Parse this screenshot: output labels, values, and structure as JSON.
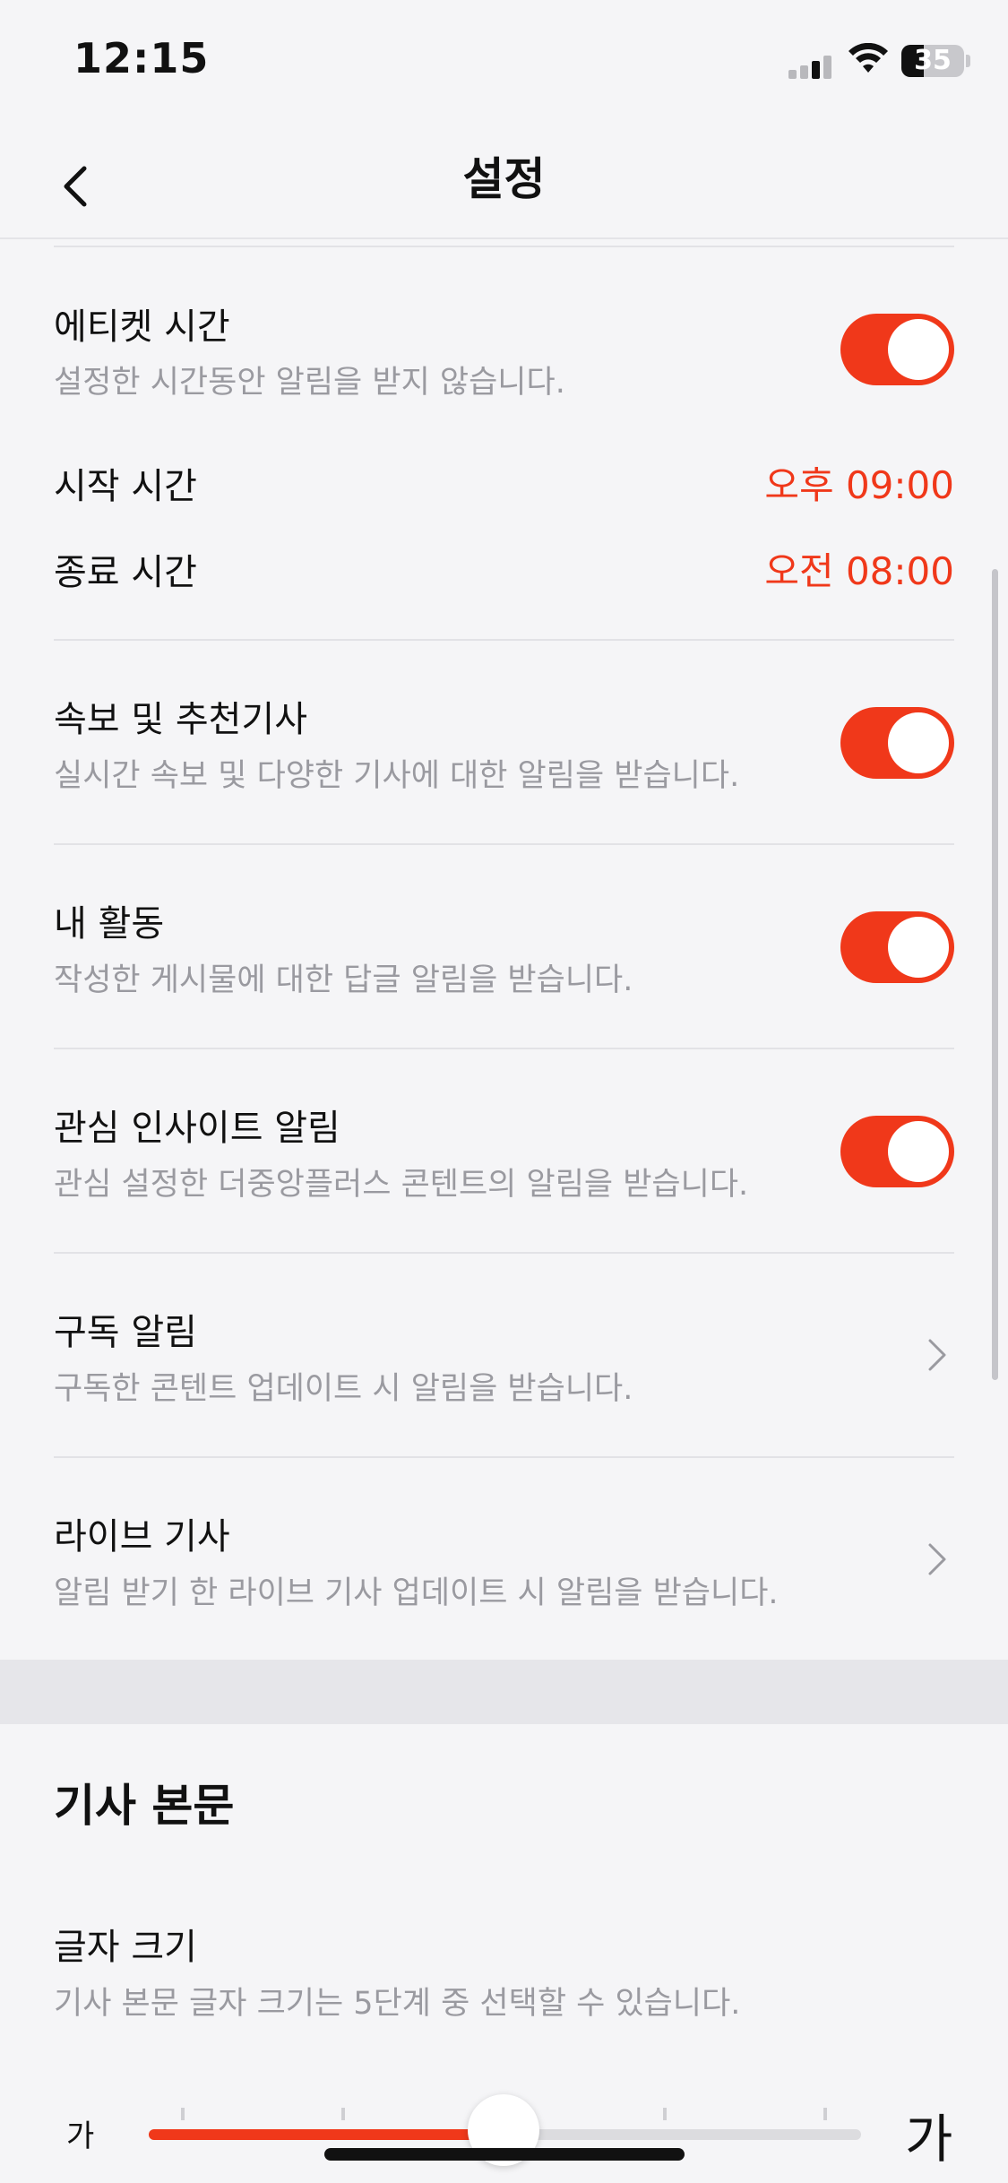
{
  "status_bar": {
    "time": "12:15",
    "battery": "35"
  },
  "nav": {
    "title": "설정"
  },
  "etiquette": {
    "title": "에티켓 시간",
    "subtitle": "설정한 시간동안 알림을 받지 않습니다.",
    "enabled": true,
    "start_label": "시작 시간",
    "start_value": "오후 09:00",
    "end_label": "종료 시간",
    "end_value": "오전 08:00"
  },
  "items": [
    {
      "title": "속보 및 추천기사",
      "subtitle": "실시간 속보 및 다양한 기사에 대한 알림을 받습니다.",
      "control": "toggle",
      "enabled": true
    },
    {
      "title": "내 활동",
      "subtitle": "작성한 게시물에 대한 답글 알림을 받습니다.",
      "control": "toggle",
      "enabled": true
    },
    {
      "title": "관심 인사이트 알림",
      "subtitle": "관심 설정한 더중앙플러스 콘텐트의 알림을 받습니다.",
      "control": "toggle",
      "enabled": true
    },
    {
      "title": "구독 알림",
      "subtitle": "구독한 콘텐트 업데이트 시 알림을 받습니다.",
      "control": "chevron"
    },
    {
      "title": "라이브 기사",
      "subtitle": "알림 받기 한 라이브 기사 업데이트 시 알림을 받습니다.",
      "control": "chevron"
    }
  ],
  "article_section": {
    "title": "기사 본문",
    "font_size_title": "글자 크기",
    "font_size_subtitle": "기사 본문 글자 크기는 5단계 중 선택할 수 있습니다.",
    "slider_small_label": "가",
    "slider_large_label": "가",
    "slider_steps": 5,
    "slider_selected_step": 3
  },
  "colors": {
    "accent": "#f0381a",
    "background": "#f5f5f7",
    "subtext": "#9a9aa0"
  }
}
